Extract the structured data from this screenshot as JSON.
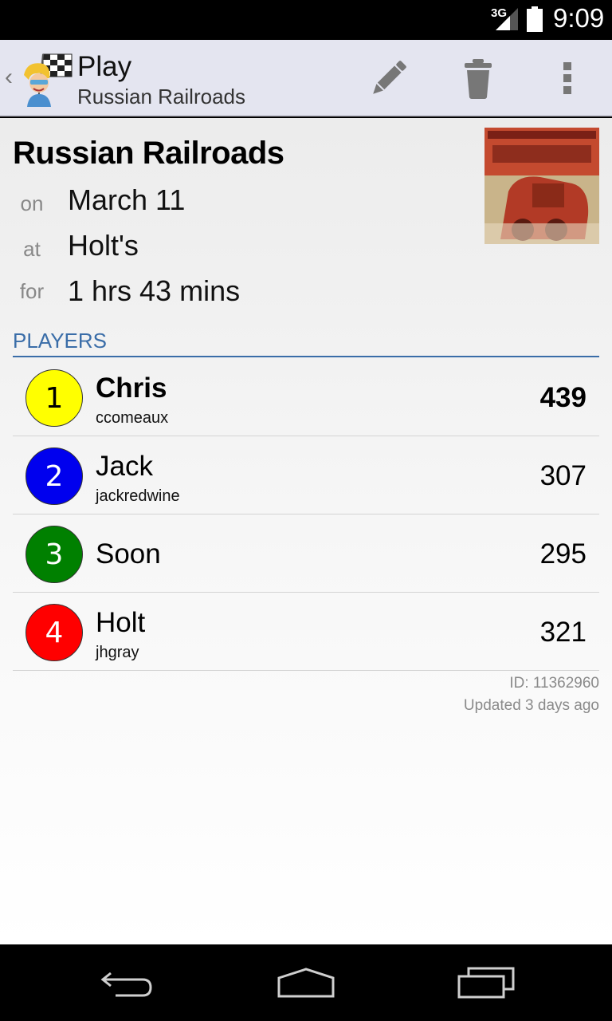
{
  "status_bar": {
    "network": "3G",
    "time": "9:09"
  },
  "action_bar": {
    "title": "Play",
    "subtitle": "Russian Railroads",
    "icons": [
      "up-chevron-icon",
      "app-logo-icon",
      "pencil-icon",
      "trash-icon",
      "overflow-menu-icon"
    ]
  },
  "play": {
    "game_title": "Russian Railroads",
    "on_label": "on",
    "date": "March 11",
    "at_label": "at",
    "location": "Holt's",
    "for_label": "for",
    "duration": "1 hrs 43 mins"
  },
  "players_header": "PLAYERS",
  "players": [
    {
      "seat": "1",
      "name": "Chris",
      "username": "ccomeaux",
      "score": "439",
      "color": "#ffff00",
      "text_color": "#000000",
      "winner": true
    },
    {
      "seat": "2",
      "name": "Jack",
      "username": "jackredwine",
      "score": "307",
      "color": "#0000ee",
      "text_color": "#ffffff",
      "winner": false
    },
    {
      "seat": "3",
      "name": "Soon",
      "username": "",
      "score": "295",
      "color": "#008000",
      "text_color": "#ffffff",
      "winner": false
    },
    {
      "seat": "4",
      "name": "Holt",
      "username": "jhgray",
      "score": "321",
      "color": "#ff0000",
      "text_color": "#ffffff",
      "winner": false
    }
  ],
  "meta": {
    "id": "ID: 11362960",
    "updated": "Updated 3 days ago"
  },
  "nav_bar": {
    "icons": [
      "back-icon",
      "home-icon",
      "recents-icon"
    ]
  }
}
